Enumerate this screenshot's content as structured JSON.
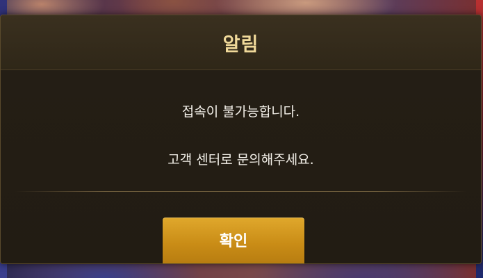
{
  "dialog": {
    "title": "알림",
    "message_lines": [
      "접속이 불가능합니다.",
      "고객 센터로 문의해주세요."
    ],
    "confirm_label": "확인"
  },
  "colors": {
    "title_color": "#f0d99a",
    "panel_background": "#2b2419",
    "button_gold": "#d19a20",
    "message_text": "#f4f1ea"
  }
}
